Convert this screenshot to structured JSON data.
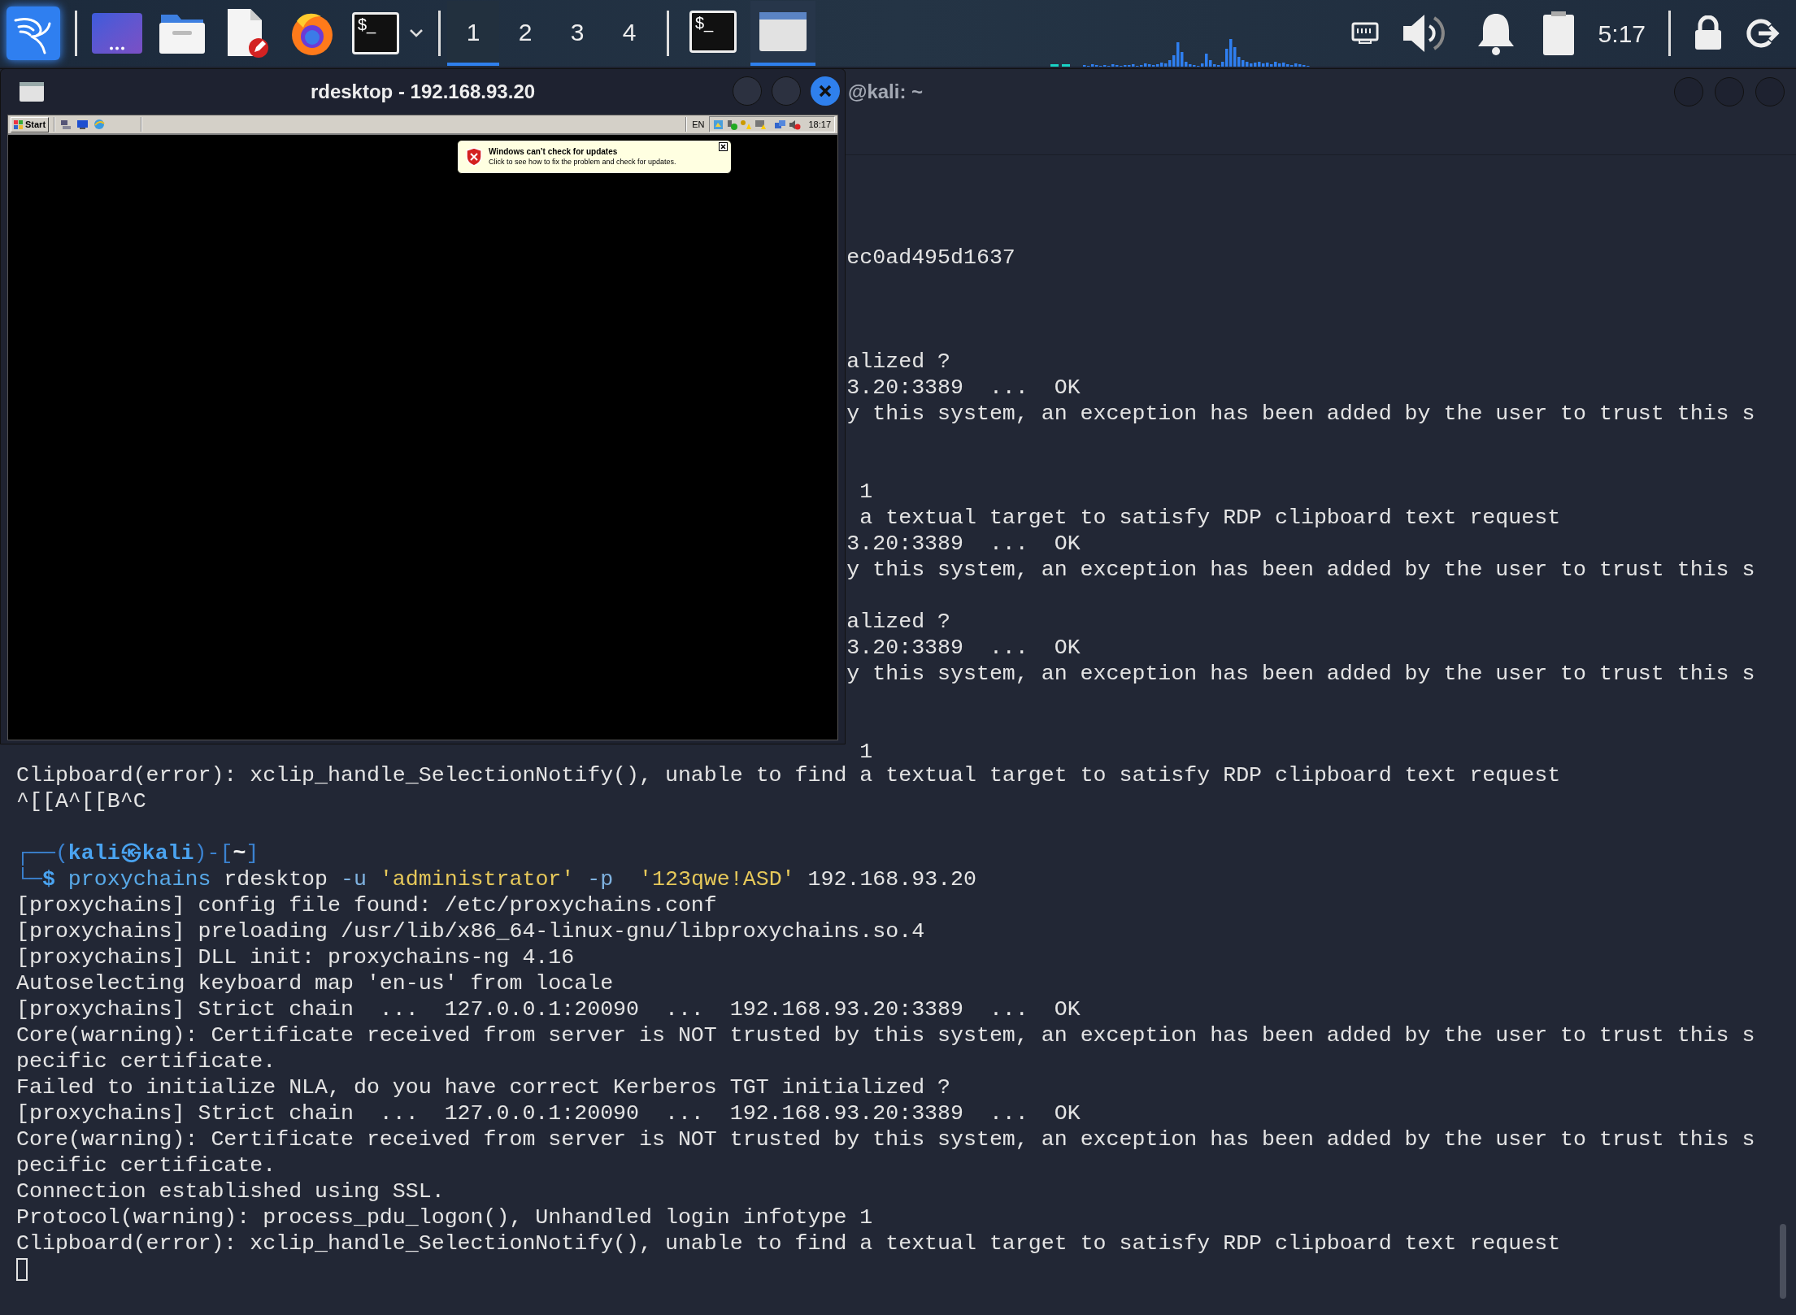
{
  "panel": {
    "launchers": [
      {
        "kind": "menu"
      },
      {
        "kind": "desktop"
      },
      {
        "kind": "files"
      },
      {
        "kind": "editor"
      },
      {
        "kind": "browser"
      },
      {
        "kind": "terminal",
        "glyph": "$_"
      }
    ],
    "workspaces": [
      {
        "label": "1",
        "selected": true
      },
      {
        "label": "2",
        "selected": false
      },
      {
        "label": "3",
        "selected": false
      },
      {
        "label": "4",
        "selected": false
      }
    ],
    "tasks": [
      {
        "kind": "terminal",
        "glyph": "$_",
        "selected": false
      },
      {
        "kind": "window",
        "selected": true
      }
    ],
    "clock": "5:17"
  },
  "rdesktop": {
    "title": "rdesktop - 192.168.93.20",
    "start": "Start",
    "language": "EN",
    "time": "18:17",
    "balloon": {
      "title": "Windows can’t check for updates",
      "text": "Click to see how to fix the problem and check for updates."
    }
  },
  "terminal": {
    "title": "@kali: ~",
    "lines": [
      {
        "kind": "fragment",
        "text": "ec0ad495d1637"
      },
      {
        "kind": "blank"
      },
      {
        "kind": "blank"
      },
      {
        "kind": "blank"
      },
      {
        "kind": "fragment",
        "text": "alized ?"
      },
      {
        "kind": "fragment",
        "text": "3.20:3389  ...  OK"
      },
      {
        "kind": "fragment",
        "text": "y this system, an exception has been added by the user to trust this s"
      },
      {
        "kind": "blank"
      },
      {
        "kind": "blank"
      },
      {
        "kind": "fragment",
        "text": " 1"
      },
      {
        "kind": "fragment",
        "text": " a textual target to satisfy RDP clipboard text request"
      },
      {
        "kind": "fragment",
        "text": "3.20:3389  ...  OK"
      },
      {
        "kind": "fragment",
        "text": "y this system, an exception has been added by the user to trust this s"
      },
      {
        "kind": "blank"
      },
      {
        "kind": "fragment",
        "text": "alized ?"
      },
      {
        "kind": "fragment",
        "text": "3.20:3389  ...  OK"
      },
      {
        "kind": "fragment",
        "text": "y this system, an exception has been added by the user to trust this s"
      },
      {
        "kind": "blank"
      },
      {
        "kind": "blank"
      },
      {
        "kind": "fragment",
        "text": " 1"
      },
      {
        "kind": "full",
        "text": "Clipboard(error): xclip_handle_SelectionNotify(), unable to find a textual target to satisfy RDP clipboard text request"
      },
      {
        "kind": "full",
        "text": "^[[A^[[B^C"
      },
      {
        "kind": "blank"
      },
      {
        "kind": "prompt",
        "segments": [
          {
            "kind": "frame",
            "text": "┌──("
          },
          {
            "kind": "user",
            "text": "kali㉿kali"
          },
          {
            "kind": "frame",
            "text": ")-["
          },
          {
            "kind": "dir",
            "text": "~"
          },
          {
            "kind": "frame",
            "text": "]"
          }
        ]
      },
      {
        "kind": "prompt",
        "segments": [
          {
            "kind": "frame",
            "text": "└─"
          },
          {
            "kind": "user",
            "text": "$"
          },
          {
            "kind": "command",
            "text": " proxychains"
          },
          {
            "kind": "plain",
            "text": " rdesktop "
          },
          {
            "kind": "option",
            "text": "-u"
          },
          {
            "kind": "string",
            "text": " 'administrator'"
          },
          {
            "kind": "option",
            "text": " -p"
          },
          {
            "kind": "string",
            "text": "  '123qwe!ASD'"
          },
          {
            "kind": "plain",
            "text": " 192.168.93.20"
          }
        ]
      },
      {
        "kind": "full",
        "text": "[proxychains] config file found: /etc/proxychains.conf"
      },
      {
        "kind": "full",
        "text": "[proxychains] preloading /usr/lib/x86_64-linux-gnu/libproxychains.so.4"
      },
      {
        "kind": "full",
        "text": "[proxychains] DLL init: proxychains-ng 4.16"
      },
      {
        "kind": "full",
        "text": "Autoselecting keyboard map 'en-us' from locale"
      },
      {
        "kind": "full",
        "text": "[proxychains] Strict chain  ...  127.0.0.1:20090  ...  192.168.93.20:3389  ...  OK"
      },
      {
        "kind": "full",
        "text": "Core(warning): Certificate received from server is NOT trusted by this system, an exception has been added by the user to trust this s"
      },
      {
        "kind": "full",
        "text": "pecific certificate."
      },
      {
        "kind": "full",
        "text": "Failed to initialize NLA, do you have correct Kerberos TGT initialized ?"
      },
      {
        "kind": "full",
        "text": "[proxychains] Strict chain  ...  127.0.0.1:20090  ...  192.168.93.20:3389  ...  OK"
      },
      {
        "kind": "full",
        "text": "Core(warning): Certificate received from server is NOT trusted by this system, an exception has been added by the user to trust this s"
      },
      {
        "kind": "full",
        "text": "pecific certificate."
      },
      {
        "kind": "full",
        "text": "Connection established using SSL."
      },
      {
        "kind": "full",
        "text": "Protocol(warning): process_pdu_logon(), Unhandled login infotype 1"
      },
      {
        "kind": "full",
        "text": "Clipboard(error): xclip_handle_SelectionNotify(), unable to find a textual target to satisfy RDP clipboard text request"
      },
      {
        "kind": "cursor"
      }
    ]
  }
}
